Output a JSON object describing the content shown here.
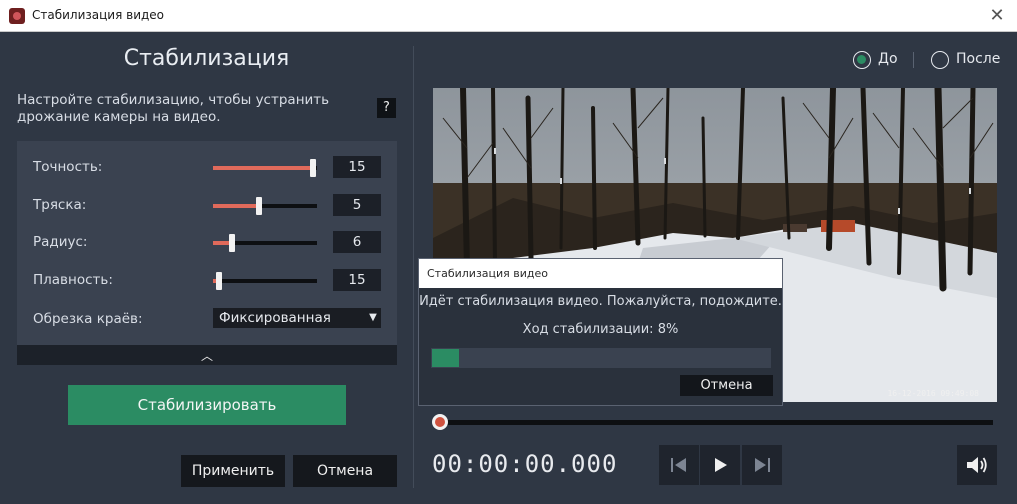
{
  "window": {
    "title": "Стабилизация видео",
    "close_glyph": "✕"
  },
  "panel": {
    "title": "Стабилизация",
    "description": "Настройте стабилизацию, чтобы устранить дрожание камеры на видео.",
    "help_label": "?",
    "params": [
      {
        "label": "Точность:",
        "value": "15",
        "level": 0.96
      },
      {
        "label": "Тряска:",
        "value": "5",
        "level": 0.44
      },
      {
        "label": "Радиус:",
        "value": "6",
        "level": 0.18
      },
      {
        "label": "Плавность:",
        "value": "15",
        "level": 0.06
      }
    ],
    "crop": {
      "label": "Обрезка краёв:",
      "selected": "Фиксированная"
    },
    "collapse_glyph": "︿"
  },
  "buttons": {
    "stabilize": "Стабилизировать",
    "apply": "Применить",
    "cancel": "Отмена"
  },
  "compare": {
    "before": "До",
    "after": "После",
    "selected": "before"
  },
  "video": {
    "timestamp": "16-12-2016 09:49:08"
  },
  "dialog": {
    "title": "Стабилизация видео",
    "message": "Идёт стабилизация видео. Пожалуйста, подождите.",
    "progress_label": "Ход стабилизации: 8%",
    "progress": 0.08,
    "cancel": "Отмена"
  },
  "player": {
    "timecode": "00:00:00.000",
    "position": 0
  },
  "icons": [
    "app-icon",
    "close-icon",
    "help-icon",
    "chevron-up-icon",
    "skip-back-icon",
    "play-icon",
    "skip-forward-icon",
    "volume-icon"
  ],
  "colors": {
    "accent": "#2b8c63",
    "slider": "#e06a5b",
    "background": "#2f3744"
  }
}
